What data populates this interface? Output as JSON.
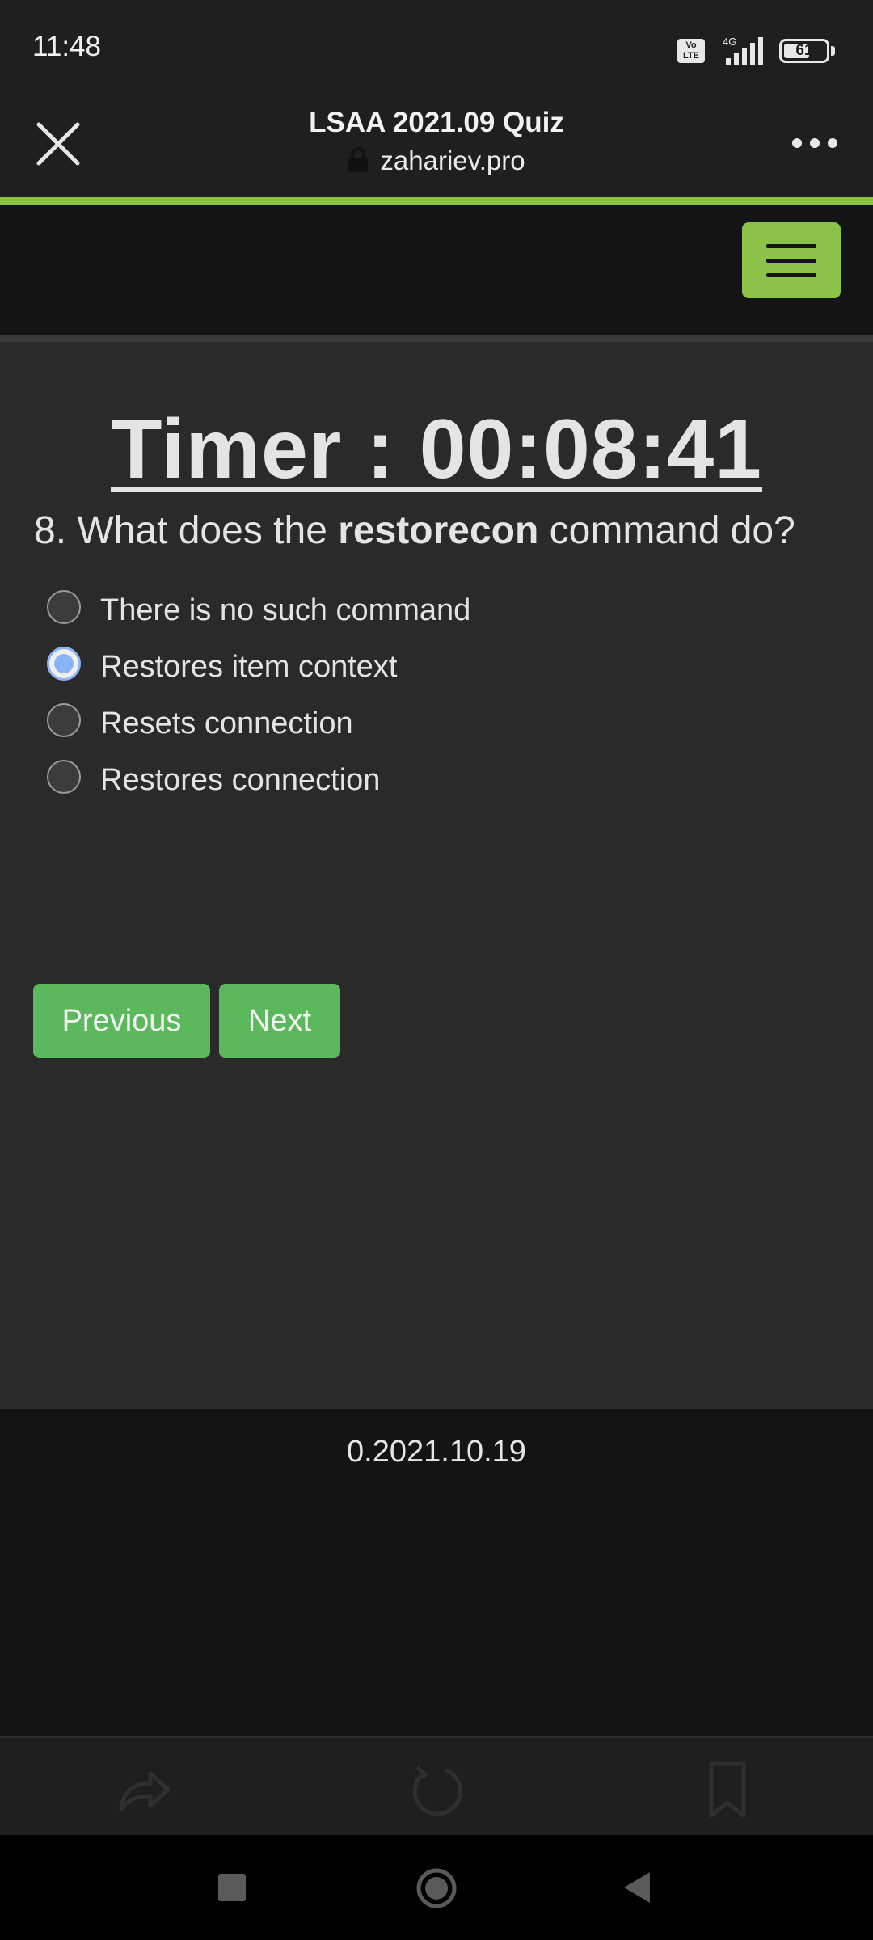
{
  "status_bar": {
    "time": "11:48",
    "volte": "Vo LTE",
    "network": "4G",
    "battery": "61",
    "battery_fraction": 0.61
  },
  "browser": {
    "page_title": "LSAA 2021.09 Quiz",
    "url": "zahariev.pro",
    "progress_color": "#8bc34a"
  },
  "quiz": {
    "timer": "Timer : 00:08:41",
    "question": {
      "number": "8. What does the ",
      "keyword": "restorecon",
      "rest": " command do?"
    },
    "options": [
      {
        "label": "There is no such command",
        "checked": false
      },
      {
        "label": "Restores item context",
        "checked": true
      },
      {
        "label": "Resets connection",
        "checked": false
      },
      {
        "label": "Restores connection",
        "checked": false
      }
    ],
    "previous_label": "Previous",
    "next_label": "Next",
    "button_color": "#5cb85c"
  },
  "footer": {
    "version": "0.2021.10.19"
  },
  "icons": {
    "close": "close-icon",
    "lock": "lock-icon",
    "more": "more-icon",
    "menu": "hamburger-icon",
    "share": "share-icon",
    "reload": "reload-icon",
    "bookmark": "bookmark-icon",
    "recents": "recents-icon",
    "home": "home-icon",
    "back": "back-icon"
  }
}
